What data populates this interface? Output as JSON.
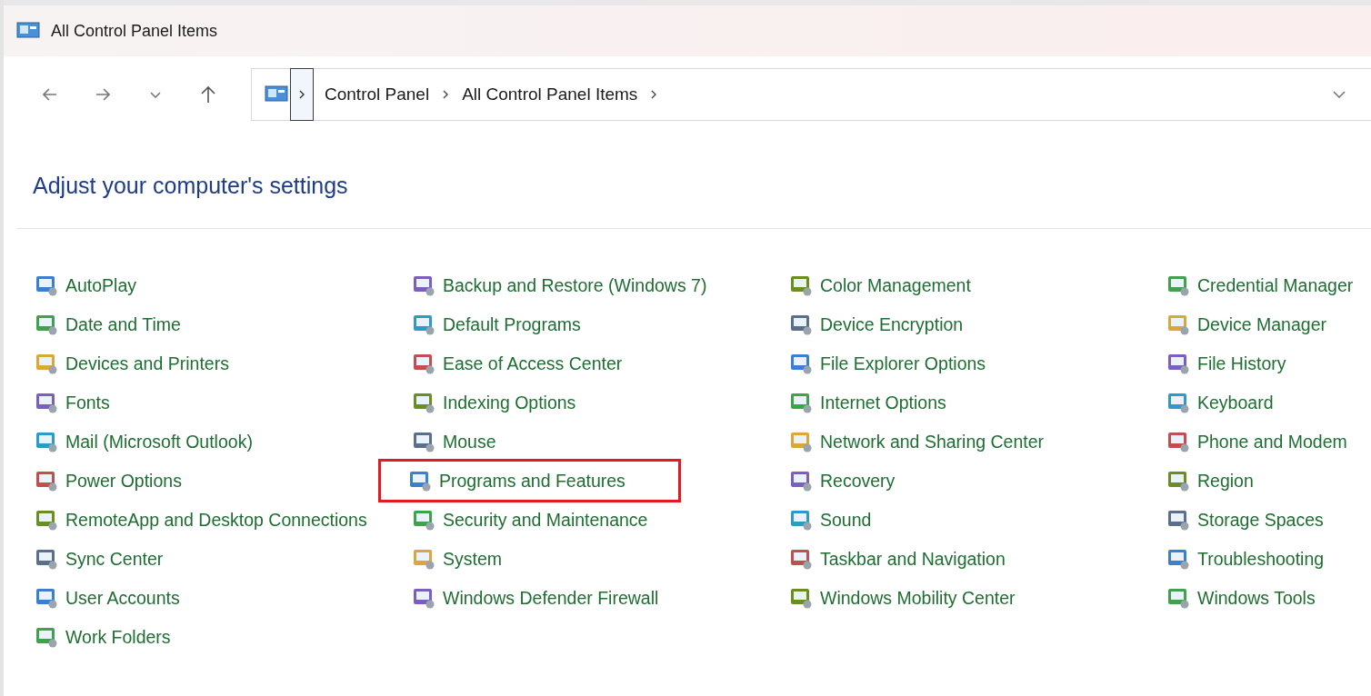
{
  "window": {
    "title": "All Control Panel Items"
  },
  "address_bar": {
    "breadcrumbs": [
      "Control Panel",
      "All Control Panel Items"
    ]
  },
  "heading": "Adjust your computer's settings",
  "columns": [
    [
      {
        "label": "AutoPlay",
        "highlighted": false
      },
      {
        "label": "Date and Time",
        "highlighted": false
      },
      {
        "label": "Devices and Printers",
        "highlighted": false
      },
      {
        "label": "Fonts",
        "highlighted": false
      },
      {
        "label": "Mail (Microsoft Outlook)",
        "highlighted": false
      },
      {
        "label": "Power Options",
        "highlighted": false
      },
      {
        "label": "RemoteApp and Desktop Connections",
        "highlighted": false
      },
      {
        "label": "Sync Center",
        "highlighted": false
      },
      {
        "label": "User Accounts",
        "highlighted": false
      },
      {
        "label": "Work Folders",
        "highlighted": false
      }
    ],
    [
      {
        "label": "Backup and Restore (Windows 7)",
        "highlighted": false
      },
      {
        "label": "Default Programs",
        "highlighted": false
      },
      {
        "label": "Ease of Access Center",
        "highlighted": false
      },
      {
        "label": "Indexing Options",
        "highlighted": false
      },
      {
        "label": "Mouse",
        "highlighted": false
      },
      {
        "label": "Programs and Features",
        "highlighted": true
      },
      {
        "label": "Security and Maintenance",
        "highlighted": false
      },
      {
        "label": "System",
        "highlighted": false
      },
      {
        "label": "Windows Defender Firewall",
        "highlighted": false
      }
    ],
    [
      {
        "label": "Color Management",
        "highlighted": false
      },
      {
        "label": "Device Encryption",
        "highlighted": false
      },
      {
        "label": "File Explorer Options",
        "highlighted": false
      },
      {
        "label": "Internet Options",
        "highlighted": false
      },
      {
        "label": "Network and Sharing Center",
        "highlighted": false
      },
      {
        "label": "Recovery",
        "highlighted": false
      },
      {
        "label": "Sound",
        "highlighted": false
      },
      {
        "label": "Taskbar and Navigation",
        "highlighted": false
      },
      {
        "label": "Windows Mobility Center",
        "highlighted": false
      }
    ],
    [
      {
        "label": "Credential Manager",
        "highlighted": false
      },
      {
        "label": "Device Manager",
        "highlighted": false
      },
      {
        "label": "File History",
        "highlighted": false
      },
      {
        "label": "Keyboard",
        "highlighted": false
      },
      {
        "label": "Phone and Modem",
        "highlighted": false
      },
      {
        "label": "Region",
        "highlighted": false
      },
      {
        "label": "Storage Spaces",
        "highlighted": false
      },
      {
        "label": "Troubleshooting",
        "highlighted": false
      },
      {
        "label": "Windows Tools",
        "highlighted": false
      }
    ]
  ]
}
